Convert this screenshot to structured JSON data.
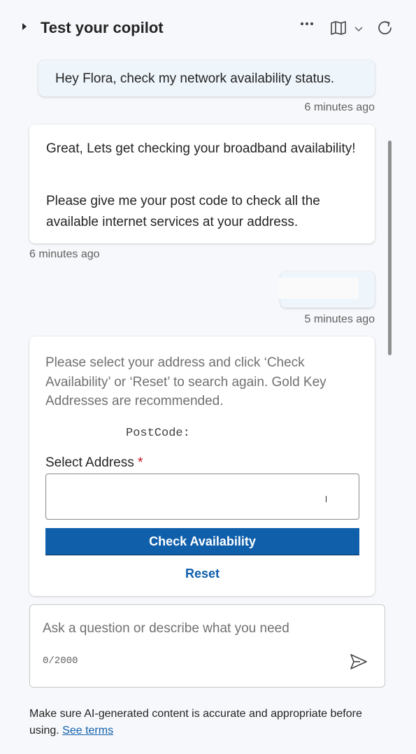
{
  "header": {
    "title": "Test your copilot",
    "more_icon": "more-horizontal-icon",
    "map_icon": "map-icon",
    "chevron_icon": "chevron-down-icon",
    "refresh_icon": "refresh-icon"
  },
  "messages": [
    {
      "role": "user",
      "text": "Hey Flora, check my network availability status.",
      "time": "6 minutes ago"
    },
    {
      "role": "bot",
      "paragraphs": [
        "Great, Lets get checking your broadband availability!",
        "Please give me your post code to check all the available internet services at your address."
      ],
      "time": "6 minutes ago"
    },
    {
      "role": "user",
      "text": "",
      "time": "5 minutes ago"
    }
  ],
  "card": {
    "instructions": "Please select your address and click ‘Check Availability’ or ‘Reset’ to search again. Gold Key Addresses are recommended.",
    "postcode_label": "PostCode:",
    "select_label": "Select Address",
    "required_mark": "*",
    "select_value": "",
    "check_button": "Check Availability",
    "reset_button": "Reset"
  },
  "composer": {
    "placeholder": "Ask a question or describe what you need",
    "counter": "0/2000",
    "send_icon": "send-icon"
  },
  "footer": {
    "text": "Make sure AI-generated content is accurate and appropriate before using.",
    "link": "See terms"
  },
  "colors": {
    "accent": "#0f5fab",
    "user_bubble": "#eef5fb",
    "required": "#c50f1f"
  }
}
